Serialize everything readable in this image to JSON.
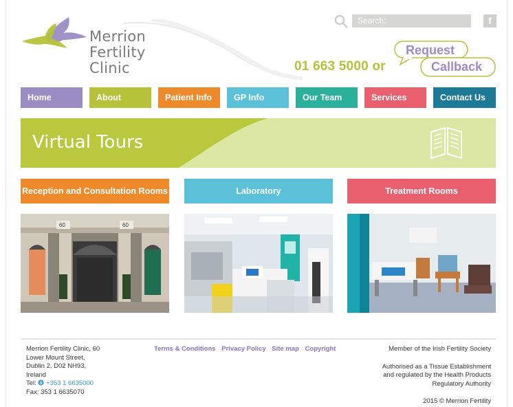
{
  "header": {
    "logo_lines": [
      "Merrion",
      "Fertility",
      "Clinic"
    ],
    "search_placeholder": "Search:",
    "facebook_glyph": "f",
    "phone": "01 663 5000 or",
    "callback_line1": "Request",
    "callback_line2": "Callback",
    "icons": [
      "logo-birds-icon",
      "search-icon",
      "facebook-icon",
      "speech-bubble-icon"
    ]
  },
  "nav": {
    "items": [
      {
        "label": "Home",
        "color": "#9b8cc4"
      },
      {
        "label": "About",
        "color": "#b6c23a"
      },
      {
        "label": "Patient Info",
        "color": "#ee8a2a"
      },
      {
        "label": "GP Info",
        "color": "#5bc1d9"
      },
      {
        "label": "Our Team",
        "color": "#2bb09c"
      },
      {
        "label": "Services",
        "color": "#e85f6e"
      },
      {
        "label": "Contact Us",
        "color": "#1c7a97"
      }
    ]
  },
  "banner": {
    "title": "Virtual Tours",
    "icon": "open-book-icon",
    "colors": {
      "light": "#dce7a4",
      "dark": "#b9c83c"
    }
  },
  "tours": [
    {
      "label": "Reception and Consultation Rooms",
      "color": "#ee8a2a",
      "image": "clinic-entrance-photo"
    },
    {
      "label": "Laboratory",
      "color": "#5bc1d9",
      "image": "laboratory-photo"
    },
    {
      "label": "Treatment Rooms",
      "color": "#e85f6e",
      "image": "treatment-room-photo"
    }
  ],
  "footer": {
    "address_lines": [
      "Merrion Fertility Clinic, 60",
      "Lower Mount Street,",
      "Dublin 2, D02 NH93,",
      "Ireland"
    ],
    "tel_label": "Tel:",
    "tel_number": "+353 1 6635000",
    "fax": "Fax: 353 1 6635070",
    "links": [
      "Terms & Conditions",
      "Privacy Policy",
      "Site map",
      "Copyright"
    ],
    "member": "Member of the Irish Fertility Society",
    "authorised_lines": [
      "Authorised as a Tissue Establishment",
      "and regulated by the Health Products",
      "Regulatory Authority"
    ],
    "copyright": "2015 © Merrion Fertility"
  }
}
